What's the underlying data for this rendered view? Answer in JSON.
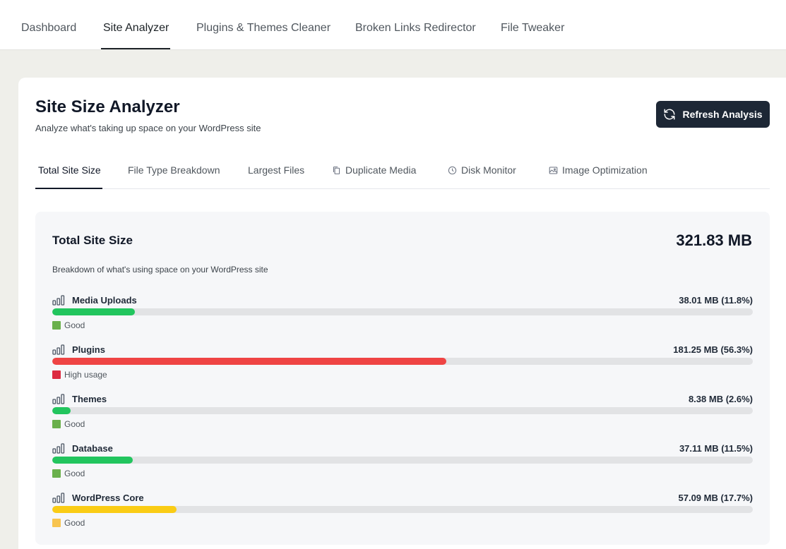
{
  "top_nav": {
    "tabs": [
      {
        "label": "Dashboard"
      },
      {
        "label": "Site Analyzer"
      },
      {
        "label": "Plugins & Themes Cleaner"
      },
      {
        "label": "Broken Links Redirector"
      },
      {
        "label": "File Tweaker"
      }
    ],
    "active": "Site Analyzer"
  },
  "header": {
    "title": "Site Size Analyzer",
    "subtitle": "Analyze what's taking up space on your WordPress site",
    "refresh_label": "Refresh Analysis",
    "refresh_icon": "refresh-icon"
  },
  "sub_tabs": {
    "tabs": [
      {
        "label": "Total Site Size",
        "icon": ""
      },
      {
        "label": "File Type Breakdown",
        "icon": ""
      },
      {
        "label": "Largest Files",
        "icon": ""
      },
      {
        "label": "Duplicate Media",
        "icon": "copy-icon"
      },
      {
        "label": "Disk Monitor",
        "icon": "clock-icon"
      },
      {
        "label": "Image Optimization",
        "icon": "image-icon"
      }
    ],
    "active": "Total Site Size"
  },
  "panel": {
    "title": "Total Site Size",
    "total": "321.83 MB",
    "description": "Breakdown of what's using space on your WordPress site",
    "items": [
      {
        "label": "Media Uploads",
        "value": "38.01 MB (11.8%)",
        "percent": 11.8,
        "bar_color": "#22c55e",
        "status": "Good",
        "status_color": "#6ab04c"
      },
      {
        "label": "Plugins",
        "value": "181.25 MB (56.3%)",
        "percent": 56.3,
        "bar_color": "#ef4444",
        "status": "High usage",
        "status_color": "#dc2a40"
      },
      {
        "label": "Themes",
        "value": "8.38 MB (2.6%)",
        "percent": 2.6,
        "bar_color": "#22c55e",
        "status": "Good",
        "status_color": "#6ab04c"
      },
      {
        "label": "Database",
        "value": "37.11 MB (11.5%)",
        "percent": 11.5,
        "bar_color": "#22c55e",
        "status": "Good",
        "status_color": "#6ab04c"
      },
      {
        "label": "WordPress Core",
        "value": "57.09 MB (17.7%)",
        "percent": 17.7,
        "bar_color": "#facc15",
        "status": "Good",
        "status_color": "#f8c44f"
      }
    ]
  }
}
